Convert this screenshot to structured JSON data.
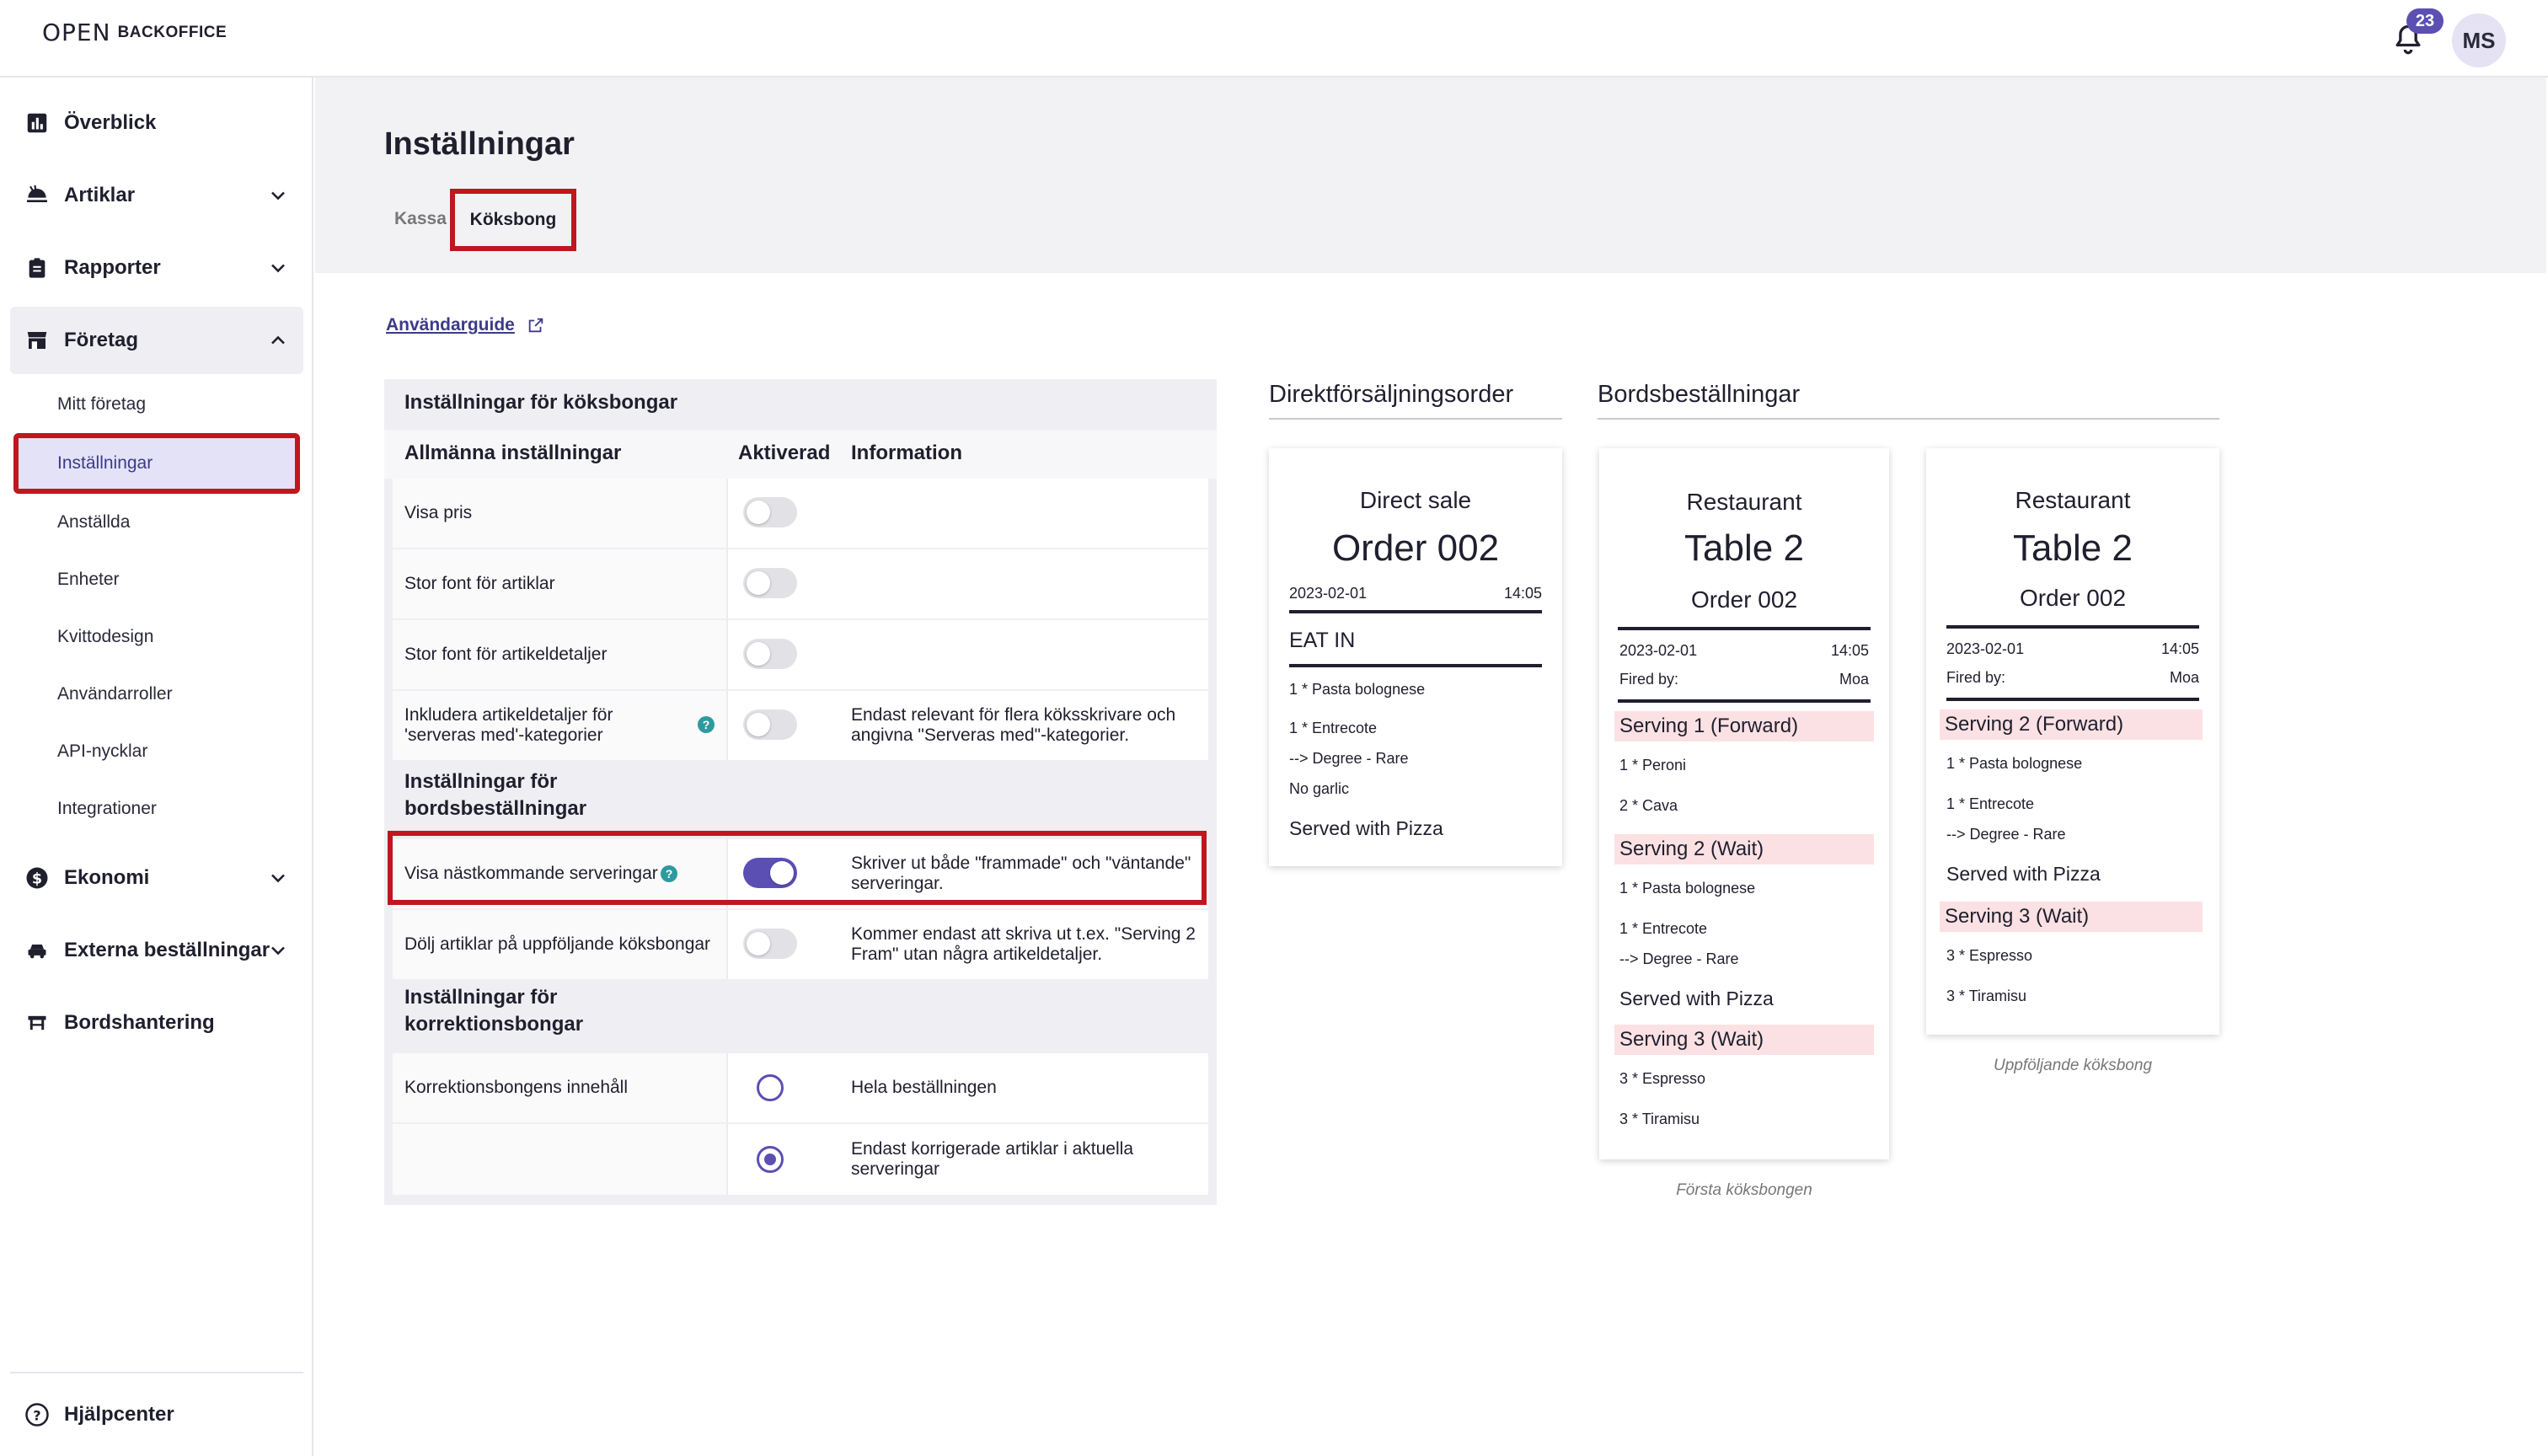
{
  "header": {
    "logo_mark": "OPEN",
    "logo_text": "BACKOFFICE",
    "notification_count": "23",
    "avatar_initials": "MS"
  },
  "sidebar": {
    "items": [
      {
        "label": "Överblick",
        "icon": "chart-icon"
      },
      {
        "label": "Artiklar",
        "icon": "food-icon"
      },
      {
        "label": "Rapporter",
        "icon": "clipboard-icon"
      },
      {
        "label": "Företag",
        "icon": "store-icon"
      },
      {
        "label": "Ekonomi",
        "icon": "dollar-icon"
      },
      {
        "label": "Externa beställningar",
        "icon": "car-icon"
      },
      {
        "label": "Bordshantering",
        "icon": "table-icon"
      }
    ],
    "company_sub": [
      "Mitt företag",
      "Inställningar",
      "Anställda",
      "Enheter",
      "Kvittodesign",
      "Användarroller",
      "API-nycklar",
      "Integrationer"
    ],
    "help_center": "Hjälpcenter"
  },
  "page": {
    "title": "Inställningar",
    "tabs": [
      "Kassa",
      "Köksbong"
    ],
    "guide_link": "Användarguide"
  },
  "settings": {
    "panel_title": "Inställningar för köksbongar",
    "col_general": "Allmänna inställningar",
    "col_enabled": "Aktiverad",
    "col_info": "Information",
    "rows": [
      {
        "label": "Visa pris",
        "info": ""
      },
      {
        "label": "Stor font för artiklar",
        "info": ""
      },
      {
        "label": "Stor font för artikeldetaljer",
        "info": ""
      },
      {
        "label": "Inkludera artikeldetaljer för 'serveras med'-kategorier",
        "info": "Endast relevant för flera köksskrivare och angivna \"Serveras med\"-kategorier."
      }
    ],
    "section_table": "Inställningar för bordsbeställningar",
    "table_rows": [
      {
        "label": "Visa nästkommande serveringar",
        "info": "Skriver ut både \"frammade\" och \"väntande\" serveringar.",
        "enabled": true
      },
      {
        "label": "Dölj artiklar på uppföljande köksbongar",
        "info": "Kommer endast att skriva ut t.ex. \"Serving 2 Fram\" utan några artikeldetaljer.",
        "enabled": false
      }
    ],
    "section_correction": "Inställningar för korrektionsbongar",
    "correction_rows": [
      {
        "label": "Korrektionsbongens innehåll",
        "info": "Hela beställningen",
        "checked": false
      },
      {
        "label": "",
        "info": "Endast korrigerade artiklar i aktuella serveringar",
        "checked": true
      }
    ],
    "help_mark": "?"
  },
  "preview": {
    "direct_title": "Direktförsäljningsorder",
    "table_title": "Bordsbeställningar",
    "direct_ticket": {
      "heading": "Direct sale",
      "order": "Order 002",
      "date": "2023-02-01",
      "time": "14:05",
      "mode": "EAT IN",
      "lines": [
        "1 * Pasta bolognese",
        "1 * Entrecote",
        "--> Degree - Rare",
        "No garlic"
      ],
      "served_with": "Served with Pizza"
    },
    "first_ticket": {
      "heading": "Restaurant",
      "table": "Table 2",
      "order": "Order 002",
      "date": "2023-02-01",
      "time": "14:05",
      "fired_label": "Fired by:",
      "fired_by": "Moa",
      "serving1": "Serving 1 (Forward)",
      "s1_lines": [
        "1 * Peroni",
        "2 * Cava"
      ],
      "serving2": "Serving 2 (Wait)",
      "s2_lines": [
        "1 * Pasta bolognese",
        "1 * Entrecote",
        "--> Degree - Rare"
      ],
      "served_with": "Served with Pizza",
      "serving3": "Serving 3 (Wait)",
      "s3_lines": [
        "3 * Espresso",
        "3 * Tiramisu"
      ],
      "caption": "Första köksbongen"
    },
    "followup_ticket": {
      "heading": "Restaurant",
      "table": "Table 2",
      "order": "Order 002",
      "date": "2023-02-01",
      "time": "14:05",
      "fired_label": "Fired by:",
      "fired_by": "Moa",
      "serving2": "Serving 2 (Forward)",
      "s2_lines": [
        "1 * Pasta bolognese",
        "1 * Entrecote",
        "--> Degree - Rare"
      ],
      "served_with": "Served with Pizza",
      "serving3": "Serving 3 (Wait)",
      "s3_lines": [
        "3 * Espresso",
        "3 * Tiramisu"
      ],
      "caption": "Uppföljande köksbong"
    }
  },
  "colors": {
    "accent": "#5b4fb3",
    "highlight_border": "#c0161f",
    "serving_bg": "#fbe1e3",
    "help_icon": "#2e9a9e"
  }
}
